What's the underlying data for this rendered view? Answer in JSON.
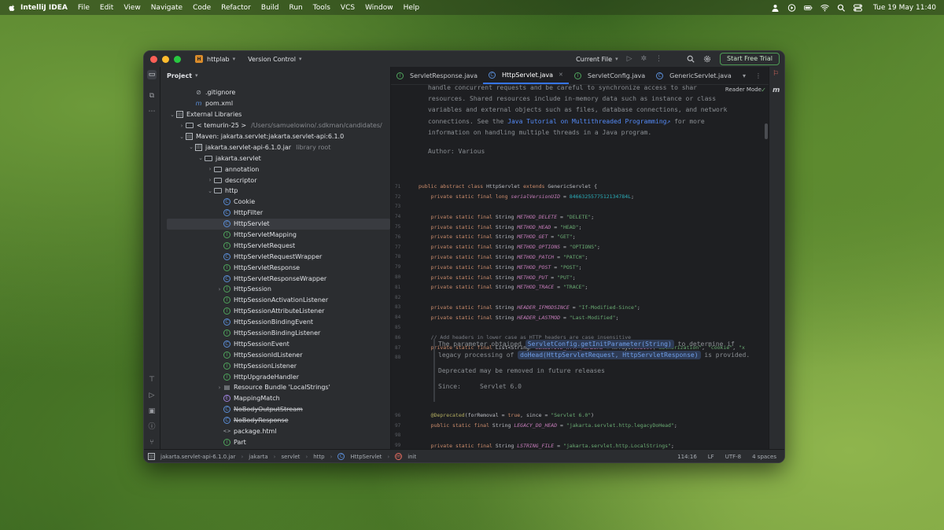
{
  "menubar": {
    "app_name": "IntelliJ IDEA",
    "items": [
      "File",
      "Edit",
      "View",
      "Navigate",
      "Code",
      "Refactor",
      "Build",
      "Run",
      "Tools",
      "VCS",
      "Window",
      "Help"
    ],
    "clock": "Tue 19 May  11:40"
  },
  "titlebar": {
    "project_badge": "H",
    "project_name": "httplab",
    "vcs_label": "Version Control",
    "run_config": "Current File",
    "trial_button": "Start Free Trial"
  },
  "project_panel": {
    "title": "Project",
    "rows": [
      {
        "label": ".gitignore",
        "icon": "gitignore-icon",
        "indent": 2,
        "arrow": ""
      },
      {
        "label": "pom.xml",
        "icon": "maven-icon",
        "indent": 2,
        "arrow": ""
      },
      {
        "label": "External Libraries",
        "icon": "library-icon",
        "indent": 0,
        "arrow": "down"
      },
      {
        "label": "< temurin-25 >",
        "hint": "/Users/samuelowino/.sdkman/candidates/",
        "icon": "folder-icon",
        "indent": 1,
        "arrow": "right"
      },
      {
        "label": "Maven: jakarta.servlet:jakarta.servlet-api:6.1.0",
        "icon": "library-icon",
        "indent": 1,
        "arrow": "down"
      },
      {
        "label": "jakarta.servlet-api-6.1.0.jar",
        "hint": "library root",
        "icon": "jar-icon",
        "indent": 2,
        "arrow": "down"
      },
      {
        "label": "jakarta.servlet",
        "icon": "package-icon",
        "indent": 3,
        "arrow": "down"
      },
      {
        "label": "annotation",
        "icon": "package-icon",
        "indent": 4,
        "arrow": "right"
      },
      {
        "label": "descriptor",
        "icon": "package-icon",
        "indent": 4,
        "arrow": "right"
      },
      {
        "label": "http",
        "icon": "package-icon",
        "indent": 4,
        "arrow": "down"
      },
      {
        "label": "Cookie",
        "icon": "class-icon",
        "indent": 5,
        "arrow": ""
      },
      {
        "label": "HttpFilter",
        "icon": "class-icon",
        "indent": 5,
        "arrow": ""
      },
      {
        "label": "HttpServlet",
        "icon": "class-icon",
        "indent": 5,
        "arrow": "",
        "selected": true
      },
      {
        "label": "HttpServletMapping",
        "icon": "interface-icon",
        "indent": 5,
        "arrow": ""
      },
      {
        "label": "HttpServletRequest",
        "icon": "interface-icon",
        "indent": 5,
        "arrow": ""
      },
      {
        "label": "HttpServletRequestWrapper",
        "icon": "class-icon",
        "indent": 5,
        "arrow": ""
      },
      {
        "label": "HttpServletResponse",
        "icon": "interface-icon",
        "indent": 5,
        "arrow": ""
      },
      {
        "label": "HttpServletResponseWrapper",
        "icon": "class-icon",
        "indent": 5,
        "arrow": ""
      },
      {
        "label": "HttpSession",
        "icon": "interface-icon",
        "indent": 5,
        "arrow": "right"
      },
      {
        "label": "HttpSessionActivationListener",
        "icon": "interface-icon",
        "indent": 5,
        "arrow": ""
      },
      {
        "label": "HttpSessionAttributeListener",
        "icon": "interface-icon",
        "indent": 5,
        "arrow": ""
      },
      {
        "label": "HttpSessionBindingEvent",
        "icon": "class-icon",
        "indent": 5,
        "arrow": ""
      },
      {
        "label": "HttpSessionBindingListener",
        "icon": "interface-icon",
        "indent": 5,
        "arrow": ""
      },
      {
        "label": "HttpSessionEvent",
        "icon": "class-icon",
        "indent": 5,
        "arrow": ""
      },
      {
        "label": "HttpSessionIdListener",
        "icon": "interface-icon",
        "indent": 5,
        "arrow": ""
      },
      {
        "label": "HttpSessionListener",
        "icon": "interface-icon",
        "indent": 5,
        "arrow": ""
      },
      {
        "label": "HttpUpgradeHandler",
        "icon": "interface-icon",
        "indent": 5,
        "arrow": ""
      },
      {
        "label": "Resource Bundle 'LocalStrings'",
        "icon": "resource-bundle-icon",
        "indent": 5,
        "arrow": "right"
      },
      {
        "label": "MappingMatch",
        "icon": "enum-icon",
        "indent": 5,
        "arrow": ""
      },
      {
        "label": "NoBodyOutputStream",
        "icon": "class-icon",
        "indent": 5,
        "arrow": "",
        "strike": true
      },
      {
        "label": "NoBodyResponse",
        "icon": "class-icon",
        "indent": 5,
        "arrow": "",
        "strike": true
      },
      {
        "label": "package.html",
        "icon": "html-icon",
        "indent": 5,
        "arrow": ""
      },
      {
        "label": "Part",
        "icon": "interface-icon",
        "indent": 5,
        "arrow": ""
      }
    ]
  },
  "editor": {
    "tabs": [
      {
        "label": "ServletResponse.java",
        "icon": "interface-icon",
        "active": false
      },
      {
        "label": "HttpServlet.java",
        "icon": "class-icon",
        "active": true
      },
      {
        "label": "ServletConfig.java",
        "icon": "interface-icon",
        "active": false
      },
      {
        "label": "GenericServlet.java",
        "icon": "class-icon",
        "active": false
      }
    ],
    "reader_mode": "Reader Mode",
    "doc_lines": [
      "handle concurrent requests and be careful to synchronize access to shar",
      "resources. Shared resources include in-memory data such as instance or class",
      "variables and external objects such as files, database connections, and network"
    ],
    "doc_line4_before": "connections. See the ",
    "doc_link": "Java Tutorial on Multithreaded Programming",
    "doc_line4_after": " for more",
    "doc_line5": "information on handling multiple threads in a Java program.",
    "author_label": "Author:",
    "author_value": "Various",
    "code_lines": [
      {
        "ln": "71",
        "segs": [
          [
            "kw",
            "public abstract class "
          ],
          [
            "txt",
            "HttpServlet "
          ],
          [
            "kw",
            "extends "
          ],
          [
            "txt",
            "GenericServlet {"
          ]
        ]
      },
      {
        "ln": "72",
        "segs": [
          [
            "kw",
            "    private static final long "
          ],
          [
            "fld",
            "serialVersionUID"
          ],
          [
            "txt",
            " = "
          ],
          [
            "num",
            "8466325577512134784L"
          ],
          [
            "txt",
            ";"
          ]
        ]
      },
      {
        "ln": "73",
        "segs": []
      },
      {
        "ln": "74",
        "segs": [
          [
            "kw",
            "    private static final "
          ],
          [
            "txt",
            "String "
          ],
          [
            "fld",
            "METHOD_DELETE"
          ],
          [
            "txt",
            " = "
          ],
          [
            "str",
            "\"DELETE\""
          ],
          [
            "txt",
            ";"
          ]
        ]
      },
      {
        "ln": "75",
        "segs": [
          [
            "kw",
            "    private static final "
          ],
          [
            "txt",
            "String "
          ],
          [
            "fld",
            "METHOD_HEAD"
          ],
          [
            "txt",
            " = "
          ],
          [
            "str",
            "\"HEAD\""
          ],
          [
            "txt",
            ";"
          ]
        ]
      },
      {
        "ln": "76",
        "segs": [
          [
            "kw",
            "    private static final "
          ],
          [
            "txt",
            "String "
          ],
          [
            "fld",
            "METHOD_GET"
          ],
          [
            "txt",
            " = "
          ],
          [
            "str",
            "\"GET\""
          ],
          [
            "txt",
            ";"
          ]
        ]
      },
      {
        "ln": "77",
        "segs": [
          [
            "kw",
            "    private static final "
          ],
          [
            "txt",
            "String "
          ],
          [
            "fld",
            "METHOD_OPTIONS"
          ],
          [
            "txt",
            " = "
          ],
          [
            "str",
            "\"OPTIONS\""
          ],
          [
            "txt",
            ";"
          ]
        ]
      },
      {
        "ln": "78",
        "segs": [
          [
            "kw",
            "    private static final "
          ],
          [
            "txt",
            "String "
          ],
          [
            "fld",
            "METHOD_PATCH"
          ],
          [
            "txt",
            " = "
          ],
          [
            "str",
            "\"PATCH\""
          ],
          [
            "txt",
            ";"
          ]
        ]
      },
      {
        "ln": "79",
        "segs": [
          [
            "kw",
            "    private static final "
          ],
          [
            "txt",
            "String "
          ],
          [
            "fld",
            "METHOD_POST"
          ],
          [
            "txt",
            " = "
          ],
          [
            "str",
            "\"POST\""
          ],
          [
            "txt",
            ";"
          ]
        ]
      },
      {
        "ln": "80",
        "segs": [
          [
            "kw",
            "    private static final "
          ],
          [
            "txt",
            "String "
          ],
          [
            "fld",
            "METHOD_PUT"
          ],
          [
            "txt",
            " = "
          ],
          [
            "str",
            "\"PUT\""
          ],
          [
            "txt",
            ";"
          ]
        ]
      },
      {
        "ln": "81",
        "segs": [
          [
            "kw",
            "    private static final "
          ],
          [
            "txt",
            "String "
          ],
          [
            "fld",
            "METHOD_TRACE"
          ],
          [
            "txt",
            " = "
          ],
          [
            "str",
            "\"TRACE\""
          ],
          [
            "txt",
            ";"
          ]
        ]
      },
      {
        "ln": "82",
        "segs": []
      },
      {
        "ln": "83",
        "segs": [
          [
            "kw",
            "    private static final "
          ],
          [
            "txt",
            "String "
          ],
          [
            "fld",
            "HEADER_IFMODSINCE"
          ],
          [
            "txt",
            " = "
          ],
          [
            "str",
            "\"If-Modified-Since\""
          ],
          [
            "txt",
            ";"
          ]
        ]
      },
      {
        "ln": "84",
        "segs": [
          [
            "kw",
            "    private static final "
          ],
          [
            "txt",
            "String "
          ],
          [
            "fld",
            "HEADER_LASTMOD"
          ],
          [
            "txt",
            " = "
          ],
          [
            "str",
            "\"Last-Modified\""
          ],
          [
            "txt",
            ";"
          ]
        ]
      },
      {
        "ln": "85",
        "segs": []
      },
      {
        "ln": "86",
        "segs": [
          [
            "cmt",
            "    // Add headers in lower case as HTTP headers are case insensitive"
          ]
        ]
      },
      {
        "ln": "87",
        "segs": [
          [
            "kw",
            "    private static final "
          ],
          [
            "txt",
            "List<String> "
          ],
          [
            "fld",
            "SENSITIVE_HTTP_HEADERS"
          ],
          [
            "txt",
            " = Arrays."
          ],
          [
            "fld",
            "asList"
          ],
          [
            "txt",
            "("
          ],
          [
            "str",
            "\"authorization\""
          ],
          [
            "txt",
            ", "
          ],
          [
            "str",
            "\"cookie\""
          ],
          [
            "txt",
            ", "
          ],
          [
            "str",
            "\"x"
          ]
        ]
      },
      {
        "ln": "88",
        "segs": []
      }
    ],
    "deprecation": {
      "line1_a": "The parameter obtained ",
      "pill1": "ServletConfig.getInitParameter(String)",
      "line1_b": " to determine if",
      "line2_a": "legacy processing of ",
      "pill2": "doHead(HttpServletRequest, HttpServletResponse)",
      "line2_b": " is provided.",
      "deprecated_label": "Deprecated",
      "deprecated_text": " may be removed in future releases",
      "since_label": "Since:",
      "since_value": "Servlet 6.0"
    },
    "code_lines_2": [
      {
        "ln": "96",
        "segs": [
          [
            "ann",
            "    @Deprecated"
          ],
          [
            "txt",
            "(forRemoval = "
          ],
          [
            "kw",
            "true"
          ],
          [
            "txt",
            ", since = "
          ],
          [
            "str",
            "\"Servlet 6.0\""
          ],
          [
            "txt",
            ")"
          ]
        ]
      },
      {
        "ln": "97",
        "segs": [
          [
            "kw",
            "    public static final "
          ],
          [
            "txt",
            "String "
          ],
          [
            "fld",
            "LEGACY_DO_HEAD"
          ],
          [
            "txt",
            " = "
          ],
          [
            "str",
            "\"jakarta.servlet.http.legacyDoHead\""
          ],
          [
            "txt",
            ";"
          ]
        ]
      },
      {
        "ln": "98",
        "segs": []
      },
      {
        "ln": "99",
        "segs": [
          [
            "kw",
            "    private static final "
          ],
          [
            "txt",
            "String "
          ],
          [
            "fld",
            "LSTRING_FILE"
          ],
          [
            "txt",
            " = "
          ],
          [
            "str",
            "\"jakarta.servlet.http.LocalStrings\""
          ],
          [
            "txt",
            ";"
          ]
        ]
      }
    ]
  },
  "statusbar": {
    "crumbs": [
      "jakarta.servlet-api-6.1.0.jar",
      "jakarta",
      "servlet",
      "http",
      "HttpServlet",
      "init"
    ],
    "position": "114:16",
    "line_sep": "LF",
    "encoding": "UTF-8",
    "indent": "4 spaces"
  }
}
